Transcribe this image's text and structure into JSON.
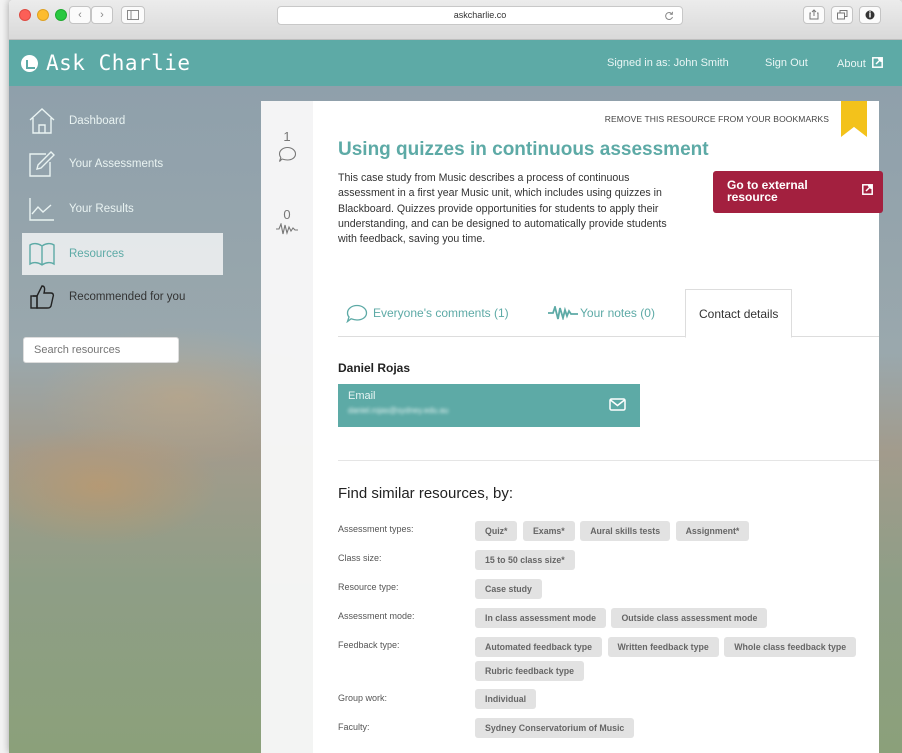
{
  "browser": {
    "url": "askcharlie.co",
    "back_glyph": "‹",
    "forward_glyph": "›"
  },
  "header": {
    "app_title": "Ask Charlie",
    "signed_in": "Signed in as: John Smith",
    "sign_out": "Sign Out",
    "about": "About"
  },
  "sidebar": {
    "items": [
      {
        "label": "Dashboard"
      },
      {
        "label": "Your Assessments"
      },
      {
        "label": "Your Results"
      },
      {
        "label": "Resources"
      },
      {
        "label": "Recommended for you"
      }
    ],
    "search_placeholder": "Search resources"
  },
  "counters": {
    "comments": "1",
    "notes": "0"
  },
  "resource": {
    "remove_bookmark": "REMOVE THIS RESOURCE FROM YOUR BOOKMARKS",
    "title": "Using quizzes in continuous assessment",
    "description": "This case study from Music describes a process of continuous assessment in a first year Music unit, which includes using quizzes in Blackboard. Quizzes provide opportunities for students to apply their understanding, and can be designed to automatically provide students with feedback, saving you time.",
    "external_button": "Go to external resource"
  },
  "tabs": [
    {
      "label": "Everyone's comments (1)"
    },
    {
      "label": "Your notes (0)"
    },
    {
      "label": "Contact details"
    }
  ],
  "contact": {
    "name": "Daniel Rojas",
    "email_label": "Email",
    "email_value": "daniel.rojas@sydney.edu.au"
  },
  "similar": {
    "heading": "Find similar resources, by:",
    "rows": [
      {
        "label": "Assessment types:",
        "tags": [
          "Quiz*",
          "Exams*",
          "Aural skills tests",
          "Assignment*"
        ]
      },
      {
        "label": "Class size:",
        "tags": [
          "15 to 50 class size*"
        ]
      },
      {
        "label": "Resource type:",
        "tags": [
          "Case study"
        ]
      },
      {
        "label": "Assessment mode:",
        "tags": [
          "In class assessment mode",
          "Outside class assessment mode"
        ]
      },
      {
        "label": "Feedback type:",
        "tags": [
          "Automated feedback type",
          "Written feedback type",
          "Whole class feedback type",
          "Rubric feedback type"
        ]
      },
      {
        "label": "Group work:",
        "tags": [
          "Individual"
        ]
      },
      {
        "label": "Faculty:",
        "tags": [
          "Sydney Conservatorium of Music"
        ]
      }
    ]
  },
  "colors": {
    "teal": "#5daaa6",
    "crimson": "#a3203f",
    "ribbon": "#f3c21b"
  }
}
